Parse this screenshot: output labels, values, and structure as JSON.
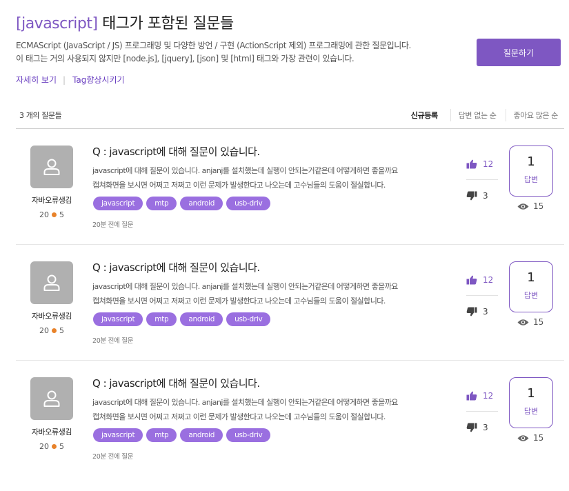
{
  "header": {
    "tag_name": "[javascript]",
    "title_rest": " 태그가 포함된 질문들",
    "description_line1": "ECMAScript (JavaScript / JS) 프로그래밍 및 다양한 방언 / 구현 (ActionScript 제외) 프로그래밍에 관한 질문입니다.",
    "description_line2": "이 태그는 거의 사용되지 않지만 [node.js], [jquery], [json] 및 [html] 태그와 가장 관련이 있습니다.",
    "ask_button_label": "질문하기",
    "link_detail": "자세히 보기",
    "link_separator": "|",
    "link_improve": "Tag향상시키기"
  },
  "list_header": {
    "count_label": "3 개의 질문들",
    "sort_options": [
      "신규등록",
      "답변 없는 순",
      "좋아요 많은 순"
    ],
    "active_sort": "신규등록"
  },
  "questions": [
    {
      "author": "자바오류생김",
      "rep_left": "20",
      "rep_right": "5",
      "title": "Q : javascript에 대해 질문이 있습니다.",
      "body_line1": "javascript에 대해 질문이 있습니다. anjanj를 설치했는데 실행이 안되는거같은데 어떻게하면 좋을까요",
      "body_line2": "캡쳐화면을 보시면 어쩌고 저쩌고 이런 문제가 발생한다고 나오는데 고수님들의 도움이 절실합니다.",
      "tags": [
        "javascript",
        "mtp",
        "android",
        "usb-driv"
      ],
      "time": "20분 전에 질문",
      "likes": "12",
      "dislikes": "3",
      "answers": "1",
      "answers_label": "답변",
      "views": "15"
    },
    {
      "author": "자바오류생김",
      "rep_left": "20",
      "rep_right": "5",
      "title": "Q : javascript에 대해 질문이 있습니다.",
      "body_line1": "javascript에 대해 질문이 있습니다. anjanj를 설치했는데 실행이 안되는거같은데 어떻게하면 좋을까요",
      "body_line2": "캡쳐화면을 보시면 어쩌고 저쩌고 이런 문제가 발생한다고 나오는데 고수님들의 도움이 절실합니다.",
      "tags": [
        "javascript",
        "mtp",
        "android",
        "usb-driv"
      ],
      "time": "20분 전에 질문",
      "likes": "12",
      "dislikes": "3",
      "answers": "1",
      "answers_label": "답변",
      "views": "15"
    },
    {
      "author": "자바오류생김",
      "rep_left": "20",
      "rep_right": "5",
      "title": "Q : javascript에 대해 질문이 있습니다.",
      "body_line1": "javascript에 대해 질문이 있습니다. anjanj를 설치했는데 실행이 안되는거같은데 어떻게하면 좋을까요",
      "body_line2": "캡쳐화면을 보시면 어쩌고 저쩌고 이런 문제가 발생한다고 나오는데 고수님들의 도움이 절실합니다.",
      "tags": [
        "javascript",
        "mtp",
        "android",
        "usb-driv"
      ],
      "time": "20분 전에 질문",
      "likes": "12",
      "dislikes": "3",
      "answers": "1",
      "answers_label": "답변",
      "views": "15"
    }
  ],
  "icons": {
    "avatar": "user-icon",
    "like": "thumbs-up-icon",
    "dislike": "thumbs-down-icon",
    "views": "eye-icon",
    "reputation_dot": "orange-dot"
  },
  "colors": {
    "accent": "#7e57c2",
    "tag_bg": "#9a6fe0",
    "avatar_bg": "#b0b0b0",
    "rep_dot": "#e8822a"
  }
}
